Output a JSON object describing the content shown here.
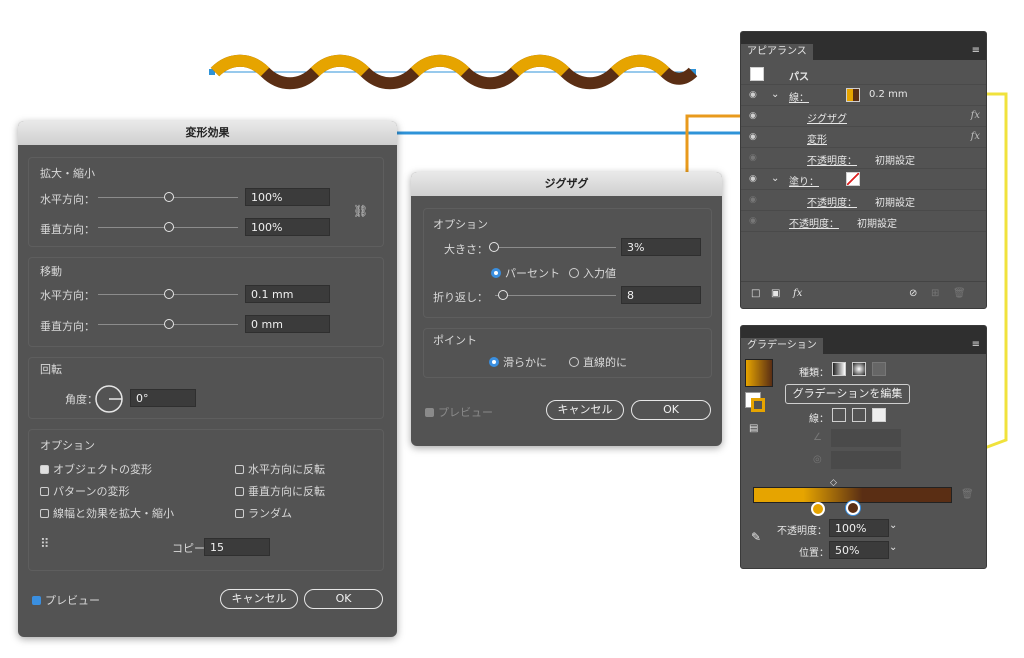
{
  "colors": {
    "blue_line": "#2f93d8",
    "orange_line": "#e89a1c",
    "yellow_line": "#f0e23c",
    "wave_front": "#e6a400",
    "wave_back": "#5a2e14"
  },
  "transform": {
    "title": "変形効果",
    "scale_label": "拡大・縮小",
    "horizontal_label": "水平方向：",
    "vertical_label": "垂直方向：",
    "scale_h": "100%",
    "scale_v": "100%",
    "move_label": "移動",
    "move_h": "0.1 mm",
    "move_v": "0 mm",
    "rotate_label": "回転",
    "angle_label": "角度：",
    "angle": "0°",
    "options_label": "オプション",
    "opt_transform_objects": "オブジェクトの変形",
    "opt_transform_patterns": "パターンの変形",
    "opt_scale_strokes": "線幅と効果を拡大・縮小",
    "opt_reflect_x": "水平方向に反転",
    "opt_reflect_y": "垂直方向に反転",
    "opt_random": "ランダム",
    "copies_label": "コピー",
    "copies": "15",
    "preview": "プレビュー",
    "cancel": "キャンセル",
    "ok": "OK"
  },
  "zigzag": {
    "title": "ジグザグ",
    "options_label": "オプション",
    "size_label": "大きさ：",
    "size": "3%",
    "relative": "パーセント",
    "absolute": "入力値",
    "ridges_label": "折り返し：",
    "ridges": "8",
    "points_label": "ポイント",
    "smooth": "滑らかに",
    "corner": "直線的に",
    "preview": "プレビュー",
    "cancel": "キャンセル",
    "ok": "OK"
  },
  "appearance": {
    "tab": "アピアランス",
    "path": "パス",
    "stroke_label": "線：",
    "stroke_value": "0.2 mm",
    "zigzag": "ジグザグ",
    "transform": "変形",
    "opacity_label": "不透明度：",
    "opacity_default": "初期設定",
    "fill_label": "塗り：",
    "fx": "fx"
  },
  "gradient": {
    "tab": "グラデーション",
    "type_label": "種類：",
    "edit_button": "グラデーションを編集",
    "stroke_label": "線：",
    "opacity_label": "不透明度：",
    "opacity": "100%",
    "location_label": "位置：",
    "location": "50%"
  }
}
